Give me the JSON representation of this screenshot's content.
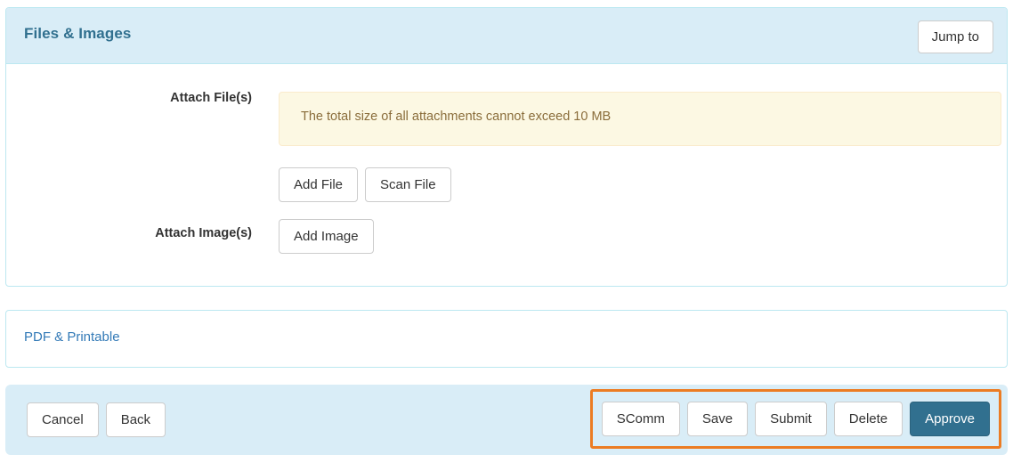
{
  "files_panel": {
    "title": "Files & Images",
    "jump_to_label": "Jump to",
    "attach_files_label": "Attach File(s)",
    "attach_images_label": "Attach Image(s)",
    "alert_text": "The total size of all attachments cannot exceed 10 MB",
    "add_file_label": "Add File",
    "scan_file_label": "Scan File",
    "add_image_label": "Add Image"
  },
  "pdf_panel": {
    "link_label": "PDF & Printable"
  },
  "footer": {
    "cancel_label": "Cancel",
    "back_label": "Back",
    "scomm_label": "SComm",
    "save_label": "Save",
    "submit_label": "Submit",
    "delete_label": "Delete",
    "approve_label": "Approve"
  },
  "colors": {
    "panel_border": "#bce8f1",
    "panel_heading_bg": "#d9edf7",
    "title_text": "#31708f",
    "alert_bg": "#fcf8e3",
    "alert_border": "#faebcc",
    "alert_text": "#8a6d3b",
    "link": "#337ab7",
    "primary_button": "#31708f",
    "highlight_outline": "#ec7c23"
  }
}
